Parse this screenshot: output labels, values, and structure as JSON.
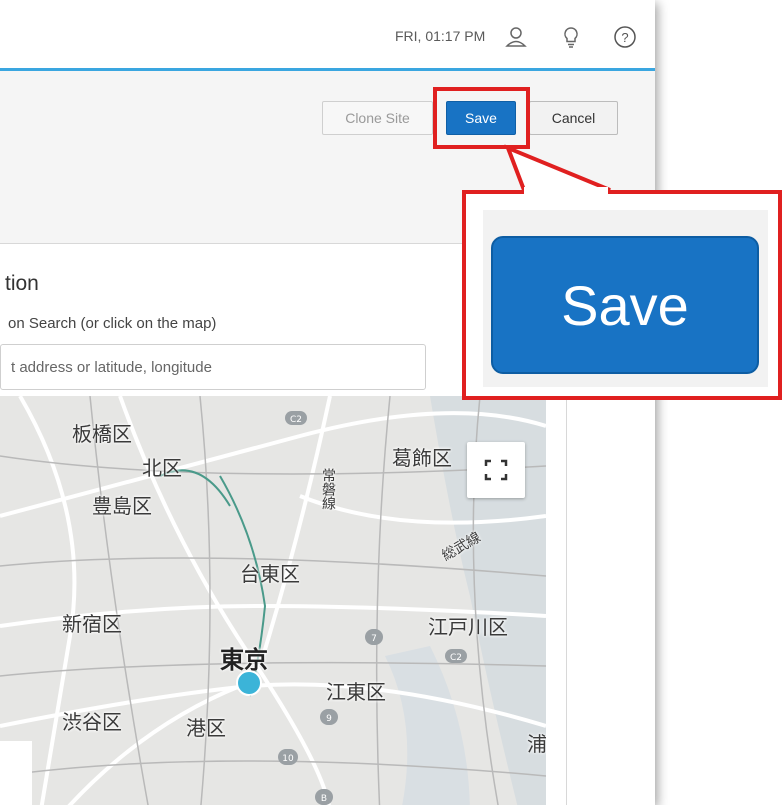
{
  "header": {
    "datetime": "FRI, 01:17 PM",
    "icons": [
      "user-icon",
      "lightbulb-icon",
      "help-icon"
    ]
  },
  "toolbar": {
    "clone_label": "Clone Site",
    "save_label": "Save",
    "cancel_label": "Cancel"
  },
  "location": {
    "title": "tion",
    "search_label": "on Search (or click on the map)",
    "search_placeholder": "t address or latitude, longitude"
  },
  "map": {
    "labels": [
      "板橋区",
      "北区",
      "豊島区",
      "葛飾区",
      "台東区",
      "常磐線",
      "総武線",
      "新宿区",
      "江戸川区",
      "東京",
      "江東区",
      "渋谷区",
      "港区",
      "浦"
    ],
    "road_badges": [
      "C2",
      "C2",
      "7",
      "9",
      "10",
      "B"
    ]
  },
  "callout": {
    "save_label": "Save"
  },
  "colors": {
    "accent": "#1873c4",
    "highlight": "#e02020",
    "topbar_line": "#3aa6e0"
  }
}
